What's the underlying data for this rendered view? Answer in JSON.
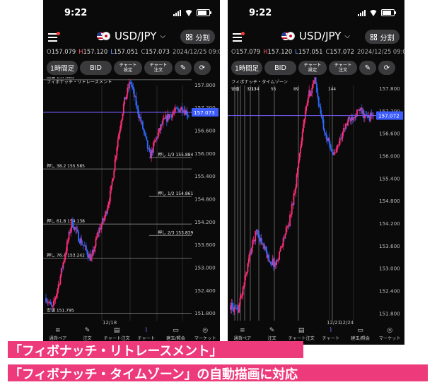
{
  "status": {
    "time": "9:22"
  },
  "header": {
    "pair": "USD/JPY",
    "split_label": "分割"
  },
  "toolbar": {
    "timeframe": "1時間足",
    "price_type": "BID",
    "chart_settings": "チャート\n設定",
    "chart_order": "チャート\n注文",
    "pen_icon": "pencil-icon",
    "rotate_icon": "rotate-icon"
  },
  "tabs": [
    {
      "label": "通貨ペア",
      "icon": "currency-pair-icon"
    },
    {
      "label": "注文",
      "icon": "order-icon"
    },
    {
      "label": "チャート注文",
      "icon": "chart-order-icon"
    },
    {
      "label": "チャート",
      "icon": "chart-icon"
    },
    {
      "label": "建玉/照会",
      "icon": "positions-icon"
    },
    {
      "label": "マーケット",
      "icon": "market-icon"
    }
  ],
  "colors": {
    "up": "#ff2d7a",
    "down": "#2e6bff",
    "current_line": "#7b5cff",
    "price_badge": "#3b5bff",
    "caption_bg": "#ec3a7a"
  },
  "left": {
    "ohlc": {
      "o": "157.079",
      "h": "157.120",
      "l": "157.051",
      "c": "157.073",
      "datetime": "2024/12/25 09:00"
    },
    "chart_data": {
      "type": "candlestick",
      "title": "フィボナッチ・リトレースメント",
      "ylim": [
        151.6,
        158.0
      ],
      "y_ticks": [
        "157.800",
        "157.200",
        "156.600",
        "156.000",
        "155.400",
        "154.800",
        "154.200",
        "153.600",
        "153.000",
        "152.400",
        "151.800"
      ],
      "current_price": "157.073",
      "x_ticks": [
        "12/18"
      ],
      "fib_levels": [
        {
          "label": "高値 157.928",
          "value": 157.928,
          "side": "left"
        },
        {
          "label": "押し 1/3 155.884",
          "value": 155.884,
          "side": "right"
        },
        {
          "label": "押し 38.2 155.585",
          "value": 155.585,
          "side": "left"
        },
        {
          "label": "押し 1/2 154.861",
          "value": 154.861,
          "side": "right"
        },
        {
          "label": "押し 61.8 154.138",
          "value": 154.138,
          "side": "left"
        },
        {
          "label": "押し 2/3 153.839",
          "value": 153.839,
          "side": "right"
        },
        {
          "label": "押し 76.4 153.242",
          "value": 153.242,
          "side": "left"
        },
        {
          "label": "安値 151.795",
          "value": 151.795,
          "side": "left"
        }
      ]
    }
  },
  "right": {
    "ohlc": {
      "o": "157.079",
      "h": "157.120",
      "l": "157.051",
      "c": "157.072",
      "datetime": "2024/12/25 09:00"
    },
    "chart_data": {
      "type": "candlestick",
      "title": "フィボナッチ・タイムゾーン",
      "ylim": [
        151.6,
        158.1
      ],
      "y_ticks": [
        "157.800",
        "157.200",
        "156.600",
        "156.000",
        "155.400",
        "154.800",
        "154.200",
        "153.600",
        "153.000",
        "152.400",
        "151.800"
      ],
      "current_price": "157.072",
      "x_ticks": [
        "12/21",
        "12/24"
      ],
      "timezone_label": "安値",
      "timezone_numbers": [
        "3",
        "21",
        "13",
        "34",
        "55",
        "89",
        "144"
      ]
    }
  },
  "captions": [
    "「フィボナッチ・リトレースメント」",
    "「フィボナッチ・タイムゾーン」の自動描画に対応"
  ]
}
